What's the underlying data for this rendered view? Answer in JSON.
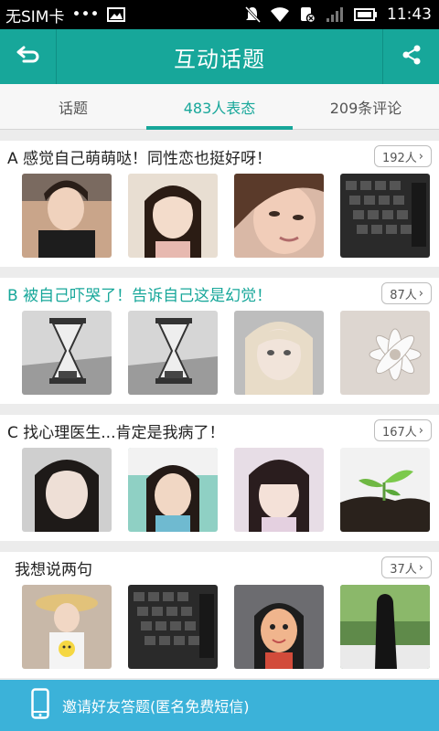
{
  "status_bar": {
    "carrier": "无SIM卡",
    "dots": "•••",
    "time": "11:43"
  },
  "header": {
    "title": "互动话题",
    "back_icon": "back-icon",
    "share_icon": "share-icon"
  },
  "tabs": [
    {
      "label": "话题"
    },
    {
      "label": "483人表态"
    },
    {
      "label": "209条评论"
    }
  ],
  "options": [
    {
      "text": "A 感觉自己萌萌哒！同性恋也挺好呀！",
      "count": "192人"
    },
    {
      "text": "B 被自己吓哭了！告诉自己这是幻觉！",
      "count": "87人"
    },
    {
      "text": "C 找心理医生...肯定是我病了！",
      "count": "167人"
    },
    {
      "text": "我想说两句",
      "count": "37人"
    }
  ],
  "bottom": {
    "label": "邀请好友答题(匿名免费短信)",
    "icon": "phone-icon"
  },
  "colors": {
    "accent": "#17a79a",
    "bottom_bar": "#3bb2d9"
  }
}
